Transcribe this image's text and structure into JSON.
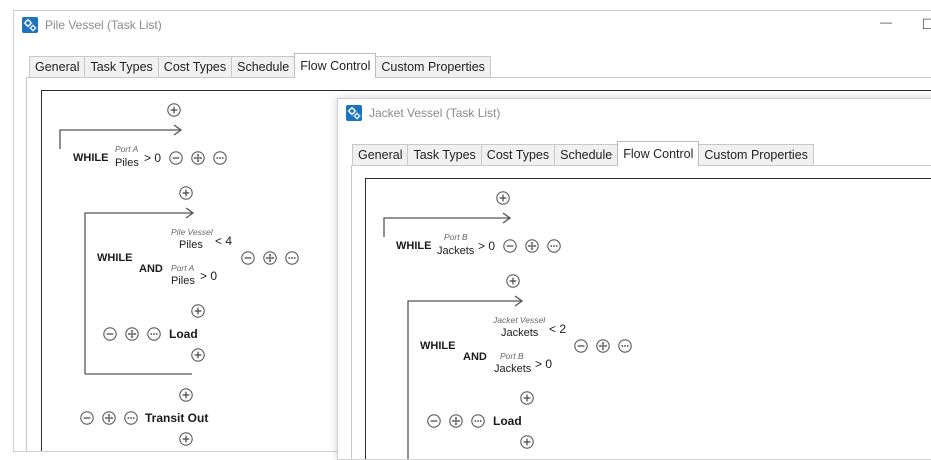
{
  "windows": [
    {
      "title": "Pile Vessel (Task List)",
      "controls": {
        "minimize": "—",
        "maximize": "☐"
      },
      "tabs": [
        "General",
        "Task Types",
        "Cost Types",
        "Schedule",
        "Flow Control",
        "Custom Properties"
      ],
      "active_tab": "Flow Control",
      "flow": {
        "outer_loop": {
          "keyword": "WHILE",
          "port": "Port A",
          "entity": "Piles",
          "op": "> 0"
        },
        "inner_loop": {
          "keyword": "WHILE",
          "cond1": {
            "port": "Pile Vessel",
            "entity": "Piles",
            "op": "< 4"
          },
          "joiner": "AND",
          "cond2": {
            "port": "Port A",
            "entity": "Piles",
            "op": "> 0"
          }
        },
        "tasks": [
          "Load",
          "Transit Out"
        ]
      }
    },
    {
      "title": "Jacket Vessel (Task List)",
      "tabs": [
        "General",
        "Task Types",
        "Cost Types",
        "Schedule",
        "Flow Control",
        "Custom Properties"
      ],
      "active_tab": "Flow Control",
      "flow": {
        "outer_loop": {
          "keyword": "WHILE",
          "port": "Port B",
          "entity": "Jackets",
          "op": "> 0"
        },
        "inner_loop": {
          "keyword": "WHILE",
          "cond1": {
            "port": "Jacket Vessel",
            "entity": "Jackets",
            "op": "< 2"
          },
          "joiner": "AND",
          "cond2": {
            "port": "Port B",
            "entity": "Jackets",
            "op": "> 0"
          }
        },
        "tasks": [
          "Load"
        ]
      }
    }
  ],
  "icons": {
    "add": "plus-circle",
    "remove": "minus-circle",
    "move": "move-arrows-circle",
    "more": "ellipsis-circle"
  },
  "colors": {
    "app_icon": "#1e73be",
    "frame_line": "#2a2a2a",
    "tab_inactive": "#f1f1f1"
  }
}
